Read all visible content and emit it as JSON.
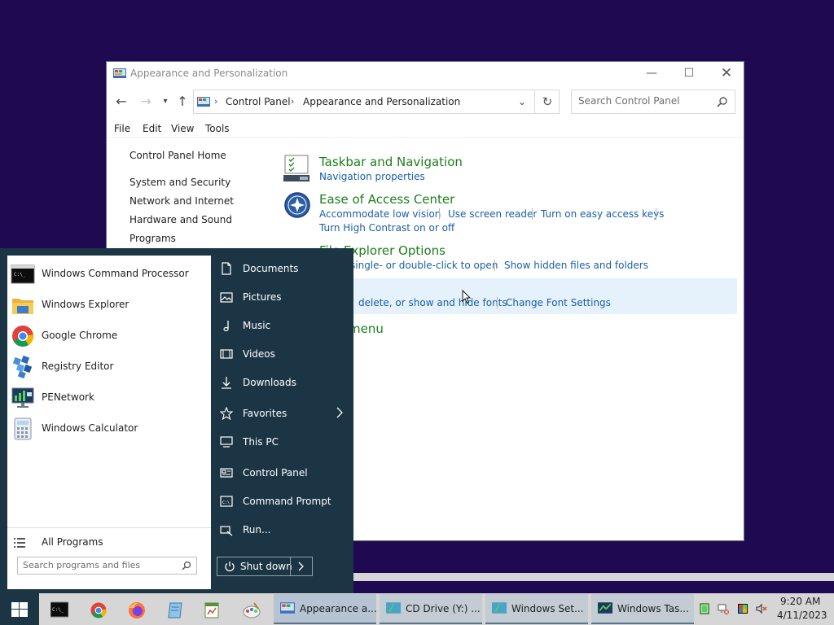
{
  "window": {
    "title": "Appearance and Personalization",
    "breadcrumb": [
      "Control Panel",
      "Appearance and Personalization"
    ],
    "search_placeholder": "Search Control Panel",
    "menu": [
      "File",
      "Edit",
      "View",
      "Tools"
    ]
  },
  "sidebar": {
    "home": "Control Panel Home",
    "items": [
      "System and Security",
      "Network and Internet",
      "Hardware and Sound",
      "Programs"
    ]
  },
  "categories": [
    {
      "title": "Taskbar and Navigation",
      "links": [
        "Navigation properties"
      ]
    },
    {
      "title": "Ease of Access Center",
      "links": [
        "Accommodate low vision",
        "Use screen reader",
        "Turn on easy access keys",
        "Turn High Contrast on or off"
      ]
    },
    {
      "title": "File Explorer Options",
      "links": [
        "single- or double-click to open",
        "Show hidden files and folders"
      ]
    },
    {
      "title": "",
      "links": [
        "delete, or show and hide fonts",
        "Change Font Settings"
      ]
    },
    {
      "title": "menu",
      "links": []
    }
  ],
  "start_menu": {
    "programs": [
      {
        "label": "Windows Command Processor",
        "icon": "cmd-icon"
      },
      {
        "label": "Windows Explorer",
        "icon": "folder-icon"
      },
      {
        "label": "Google Chrome",
        "icon": "chrome-icon"
      },
      {
        "label": "Registry Editor",
        "icon": "registry-icon"
      },
      {
        "label": "PENetwork",
        "icon": "network-icon"
      },
      {
        "label": "Windows Calculator",
        "icon": "calculator-icon"
      }
    ],
    "all_programs": "All Programs",
    "search_placeholder": "Search programs and files",
    "places": [
      "Documents",
      "Pictures",
      "Music",
      "Videos",
      "Downloads",
      "Favorites",
      "This PC",
      "Control Panel",
      "Command Prompt",
      "Run..."
    ],
    "shutdown": "Shut down"
  },
  "taskbar": {
    "tasks": [
      "Appearance a...",
      "CD Drive (Y:) ...",
      "Windows Set...",
      "Windows Tas..."
    ],
    "time": "9:20 AM",
    "date": "4/11/2023"
  },
  "colors": {
    "desktop": "#1f0a52",
    "start_menu_bg": "#1c3545",
    "category_title": "#1c7f1c",
    "link": "#1a5fa8",
    "taskbar": "#d6d6d6"
  }
}
